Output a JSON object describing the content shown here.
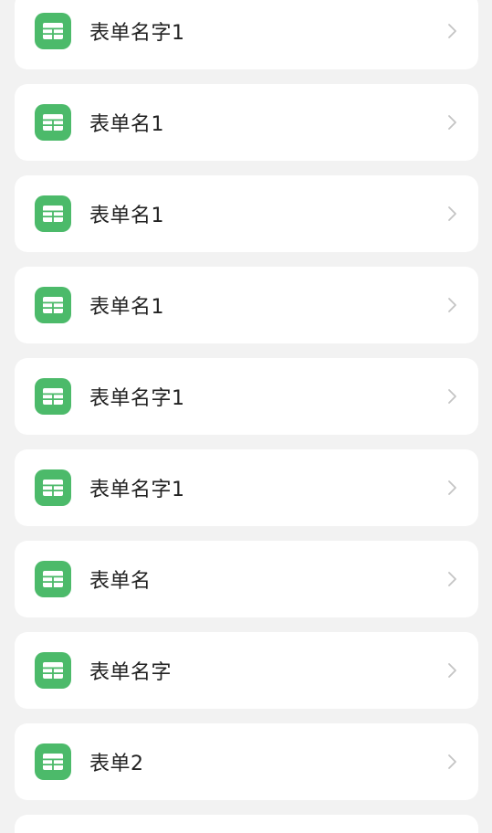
{
  "list": {
    "items": [
      {
        "label": "表单名字1"
      },
      {
        "label": "表单名1"
      },
      {
        "label": "表单名1"
      },
      {
        "label": "表单名1"
      },
      {
        "label": "表单名字1"
      },
      {
        "label": "表单名字1"
      },
      {
        "label": "表单名"
      },
      {
        "label": "表单名字"
      },
      {
        "label": "表单2"
      }
    ]
  },
  "icons": {
    "form_icon": "table-icon",
    "chevron": "chevron-right-icon"
  },
  "colors": {
    "background": "#f2f2f2",
    "card": "#ffffff",
    "accent": "#4cba6a",
    "text": "#222222",
    "chevron": "#c4c4c4"
  }
}
